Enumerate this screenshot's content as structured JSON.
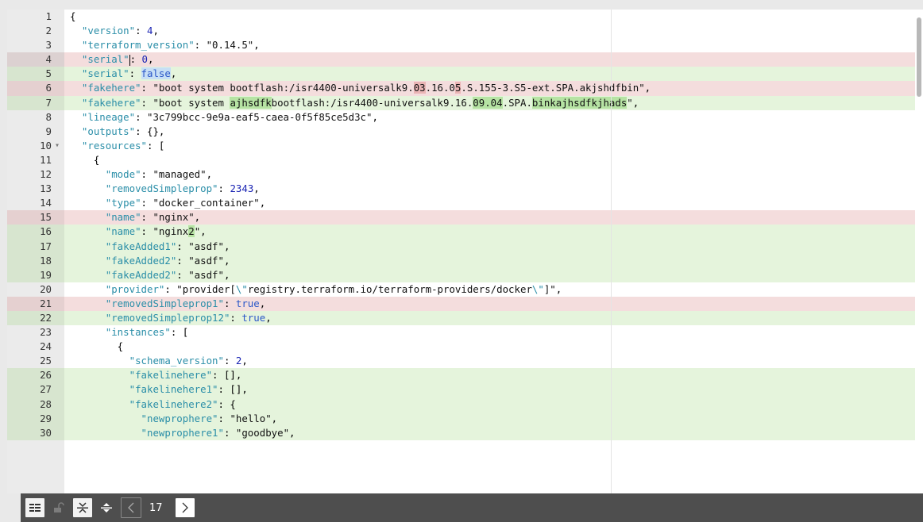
{
  "lines": [
    {
      "n": "1",
      "type": "ctx",
      "segs": [
        {
          "t": "{"
        }
      ]
    },
    {
      "n": "2",
      "type": "ctx",
      "segs": [
        {
          "t": "  "
        },
        {
          "t": "\"version\"",
          "c": "k"
        },
        {
          "t": ": "
        },
        {
          "t": "4",
          "c": "n"
        },
        {
          "t": ","
        }
      ]
    },
    {
      "n": "3",
      "type": "ctx",
      "segs": [
        {
          "t": "  "
        },
        {
          "t": "\"terraform_version\"",
          "c": "k"
        },
        {
          "t": ": "
        },
        {
          "t": "\"0.14.5\"",
          "c": "s"
        },
        {
          "t": ","
        }
      ]
    },
    {
      "n": "4",
      "type": "removed",
      "cursor": true,
      "segs": [
        {
          "t": "  "
        },
        {
          "t": "\"serial\"",
          "c": "k"
        },
        {
          "caret": true
        },
        {
          "t": ": "
        },
        {
          "t": "0",
          "c": "n"
        },
        {
          "t": ","
        }
      ]
    },
    {
      "n": "5",
      "type": "added",
      "segs": [
        {
          "t": "  "
        },
        {
          "t": "\"serial\"",
          "c": "k"
        },
        {
          "t": ": "
        },
        {
          "t": "false",
          "c": "b",
          "hl": "blue"
        },
        {
          "t": ","
        }
      ]
    },
    {
      "n": "6",
      "type": "removed",
      "segs": [
        {
          "t": "  "
        },
        {
          "t": "\"fakehere\"",
          "c": "k"
        },
        {
          "t": ": "
        },
        {
          "t": "\"boot system bootflash:/isr4400-universalk9.",
          "c": "s"
        },
        {
          "t": "03",
          "c": "s",
          "hl": "red"
        },
        {
          "t": ".",
          "c": "s"
        },
        {
          "t": "1",
          "c": "s"
        },
        {
          "t": "6.0",
          "c": "s"
        },
        {
          "t": "5",
          "c": "s",
          "hl": "red"
        },
        {
          "t": ".S.155-3.S5-ext.SPA.akjshdfbin\"",
          "c": "s"
        },
        {
          "t": ","
        }
      ]
    },
    {
      "n": "7",
      "type": "added",
      "segs": [
        {
          "t": "  "
        },
        {
          "t": "\"fakehere\"",
          "c": "k"
        },
        {
          "t": ": "
        },
        {
          "t": "\"boot system ",
          "c": "s"
        },
        {
          "t": "ajhsdfk",
          "c": "s",
          "hl": "green"
        },
        {
          "t": "bootflash:/isr4400-universalk9.16.",
          "c": "s"
        },
        {
          "t": "09.04",
          "c": "s",
          "hl": "green"
        },
        {
          "t": ".SPA.",
          "c": "s"
        },
        {
          "t": "binkajhsdfkjhads",
          "c": "s",
          "hl": "green"
        },
        {
          "t": "\"",
          "c": "s"
        },
        {
          "t": ","
        }
      ]
    },
    {
      "n": "8",
      "type": "ctx",
      "segs": [
        {
          "t": "  "
        },
        {
          "t": "\"lineage\"",
          "c": "k"
        },
        {
          "t": ": "
        },
        {
          "t": "\"3c799bcc-9e9a-eaf5-caea-0f5f85ce5d3c\"",
          "c": "s"
        },
        {
          "t": ","
        }
      ]
    },
    {
      "n": "9",
      "type": "ctx",
      "segs": [
        {
          "t": "  "
        },
        {
          "t": "\"outputs\"",
          "c": "k"
        },
        {
          "t": ": {},"
        }
      ]
    },
    {
      "n": "10",
      "type": "ctx",
      "fold": true,
      "segs": [
        {
          "t": "  "
        },
        {
          "t": "\"resources\"",
          "c": "k"
        },
        {
          "t": ": ["
        }
      ]
    },
    {
      "n": "11",
      "type": "ctx",
      "segs": [
        {
          "t": "    {"
        }
      ]
    },
    {
      "n": "12",
      "type": "ctx",
      "segs": [
        {
          "t": "      "
        },
        {
          "t": "\"mode\"",
          "c": "k"
        },
        {
          "t": ": "
        },
        {
          "t": "\"managed\"",
          "c": "s"
        },
        {
          "t": ","
        }
      ]
    },
    {
      "n": "13",
      "type": "ctx",
      "segs": [
        {
          "t": "      "
        },
        {
          "t": "\"removedSimpleprop\"",
          "c": "k"
        },
        {
          "t": ": "
        },
        {
          "t": "2343",
          "c": "n"
        },
        {
          "t": ","
        }
      ]
    },
    {
      "n": "14",
      "type": "ctx",
      "segs": [
        {
          "t": "      "
        },
        {
          "t": "\"type\"",
          "c": "k"
        },
        {
          "t": ": "
        },
        {
          "t": "\"docker_container\"",
          "c": "s"
        },
        {
          "t": ","
        }
      ]
    },
    {
      "n": "15",
      "type": "removed",
      "segs": [
        {
          "t": "      "
        },
        {
          "t": "\"name\"",
          "c": "k"
        },
        {
          "t": ": "
        },
        {
          "t": "\"nginx\"",
          "c": "s"
        },
        {
          "t": ","
        }
      ]
    },
    {
      "n": "16",
      "type": "added",
      "segs": [
        {
          "t": "      "
        },
        {
          "t": "\"name\"",
          "c": "k"
        },
        {
          "t": ": "
        },
        {
          "t": "\"nginx",
          "c": "s"
        },
        {
          "t": "2",
          "c": "s",
          "hl": "green"
        },
        {
          "t": "\"",
          "c": "s"
        },
        {
          "t": ","
        }
      ]
    },
    {
      "n": "17",
      "type": "added",
      "segs": [
        {
          "t": "      "
        },
        {
          "t": "\"fakeAdded1\"",
          "c": "k"
        },
        {
          "t": ": "
        },
        {
          "t": "\"asdf\"",
          "c": "s"
        },
        {
          "t": ","
        }
      ]
    },
    {
      "n": "18",
      "type": "added",
      "segs": [
        {
          "t": "      "
        },
        {
          "t": "\"fakeAdded2\"",
          "c": "k"
        },
        {
          "t": ": "
        },
        {
          "t": "\"asdf\"",
          "c": "s"
        },
        {
          "t": ","
        }
      ]
    },
    {
      "n": "19",
      "type": "added",
      "segs": [
        {
          "t": "      "
        },
        {
          "t": "\"fakeAdded2\"",
          "c": "k"
        },
        {
          "t": ": "
        },
        {
          "t": "\"asdf\"",
          "c": "s"
        },
        {
          "t": ","
        }
      ]
    },
    {
      "n": "20",
      "type": "ctx",
      "segs": [
        {
          "t": "      "
        },
        {
          "t": "\"provider\"",
          "c": "k"
        },
        {
          "t": ": "
        },
        {
          "t": "\"provider[",
          "c": "s"
        },
        {
          "t": "\\\"",
          "c": "k"
        },
        {
          "t": "registry.terraform.io/terraform-providers/docker",
          "c": "s"
        },
        {
          "t": "\\\"",
          "c": "k"
        },
        {
          "t": "]\"",
          "c": "s"
        },
        {
          "t": ","
        }
      ]
    },
    {
      "n": "21",
      "type": "removed",
      "segs": [
        {
          "t": "      "
        },
        {
          "t": "\"removedSimpleprop1\"",
          "c": "k"
        },
        {
          "t": ": "
        },
        {
          "t": "true",
          "c": "b"
        },
        {
          "t": ","
        }
      ]
    },
    {
      "n": "22",
      "type": "added",
      "segs": [
        {
          "t": "      "
        },
        {
          "t": "\"removedSimpleprop12\"",
          "c": "k"
        },
        {
          "t": ": "
        },
        {
          "t": "true",
          "c": "b"
        },
        {
          "t": ","
        }
      ]
    },
    {
      "n": "23",
      "type": "ctx",
      "segs": [
        {
          "t": "      "
        },
        {
          "t": "\"instances\"",
          "c": "k"
        },
        {
          "t": ": ["
        }
      ]
    },
    {
      "n": "24",
      "type": "ctx",
      "segs": [
        {
          "t": "        {"
        }
      ]
    },
    {
      "n": "25",
      "type": "ctx",
      "sep": true,
      "segs": [
        {
          "t": "          "
        },
        {
          "t": "\"schema_version\"",
          "c": "k"
        },
        {
          "t": ": "
        },
        {
          "t": "2",
          "c": "n"
        },
        {
          "t": ","
        }
      ]
    },
    {
      "n": "26",
      "type": "added",
      "segs": [
        {
          "t": "          "
        },
        {
          "t": "\"fakelinehere\"",
          "c": "k"
        },
        {
          "t": ": [],"
        }
      ]
    },
    {
      "n": "27",
      "type": "added",
      "segs": [
        {
          "t": "          "
        },
        {
          "t": "\"fakelinehere1\"",
          "c": "k"
        },
        {
          "t": ": [],"
        }
      ]
    },
    {
      "n": "28",
      "type": "added",
      "segs": [
        {
          "t": "          "
        },
        {
          "t": "\"fakelinehere2\"",
          "c": "k"
        },
        {
          "t": ": {"
        }
      ]
    },
    {
      "n": "29",
      "type": "added",
      "segs": [
        {
          "t": "            "
        },
        {
          "t": "\"newprophere\"",
          "c": "k"
        },
        {
          "t": ": "
        },
        {
          "t": "\"hello\"",
          "c": "s"
        },
        {
          "t": ","
        }
      ]
    },
    {
      "n": "30",
      "type": "added",
      "segs": [
        {
          "t": "            "
        },
        {
          "t": "\"newprophere1\"",
          "c": "k"
        },
        {
          "t": ": "
        },
        {
          "t": "\"goodbye\"",
          "c": "s"
        },
        {
          "t": ","
        }
      ]
    }
  ],
  "fold_glyph": "▾",
  "statusbar": {
    "page_number": "17",
    "icons": {
      "view": "list-view-icon",
      "lock": "unlock-icon",
      "collapse": "collapse-icon",
      "expand": "expand-icon",
      "prev": "chevron-left-icon",
      "next": "chevron-right-icon"
    }
  },
  "colors": {
    "removed_bg": "#f4dddd",
    "added_bg": "#e5f4dc",
    "key": "#2a8ea8",
    "number": "#1a24b3",
    "statusbar": "#4e4e4e"
  }
}
